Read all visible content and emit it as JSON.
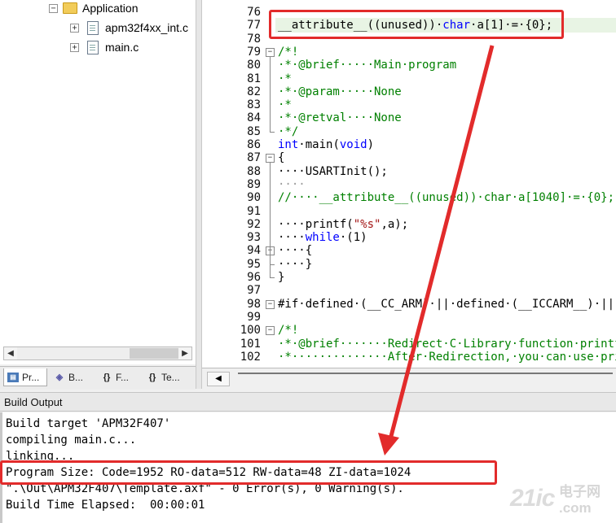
{
  "project_panel": {
    "tree": [
      {
        "label": "Application",
        "type": "folder",
        "expander": "−"
      },
      {
        "label": "apm32f4xx_int.c",
        "type": "file",
        "expander": "+"
      },
      {
        "label": "main.c",
        "type": "file",
        "expander": "+"
      }
    ],
    "tabs": [
      {
        "icon": "project-icon",
        "label": "Pr..."
      },
      {
        "icon": "books-icon",
        "label": "B..."
      },
      {
        "icon": "{}",
        "label": "F..."
      },
      {
        "icon": "{}",
        "label": "Te..."
      }
    ]
  },
  "editor": {
    "lines": [
      {
        "n": "76",
        "segments": []
      },
      {
        "n": "77",
        "segments": [
          {
            "t": "__attribute__((unused))·",
            "c": ""
          },
          {
            "t": "char",
            "c": "kw"
          },
          {
            "t": "·a[1]·=·{0};",
            "c": ""
          }
        ]
      },
      {
        "n": "78",
        "segments": []
      },
      {
        "n": "79",
        "segments": [
          {
            "t": "/*!",
            "c": "cmt"
          }
        ],
        "fold": "−"
      },
      {
        "n": "80",
        "segments": [
          {
            "t": "·*·@brief·····Main·program",
            "c": "cmt"
          }
        ]
      },
      {
        "n": "81",
        "segments": [
          {
            "t": "·*",
            "c": "cmt"
          }
        ]
      },
      {
        "n": "82",
        "segments": [
          {
            "t": "·*·@param·····None",
            "c": "cmt"
          }
        ]
      },
      {
        "n": "83",
        "segments": [
          {
            "t": "·*",
            "c": "cmt"
          }
        ]
      },
      {
        "n": "84",
        "segments": [
          {
            "t": "·*·@retval····None",
            "c": "cmt"
          }
        ]
      },
      {
        "n": "85",
        "segments": [
          {
            "t": "·*/",
            "c": "cmt"
          }
        ]
      },
      {
        "n": "86",
        "segments": [
          {
            "t": "int",
            "c": "kw"
          },
          {
            "t": "·main(",
            "c": ""
          },
          {
            "t": "void",
            "c": "kw"
          },
          {
            "t": ")",
            "c": ""
          }
        ]
      },
      {
        "n": "87",
        "segments": [
          {
            "t": "{",
            "c": ""
          }
        ],
        "fold": "−"
      },
      {
        "n": "88",
        "segments": [
          {
            "t": "····USARTInit();",
            "c": ""
          }
        ]
      },
      {
        "n": "89",
        "segments": [
          {
            "t": "····",
            "c": "dot"
          }
        ]
      },
      {
        "n": "90",
        "segments": [
          {
            "t": "//····__attribute__((unused))·char·a[1040]·=·{0};",
            "c": "cmt"
          }
        ]
      },
      {
        "n": "91",
        "segments": []
      },
      {
        "n": "92",
        "segments": [
          {
            "t": "····printf(",
            "c": ""
          },
          {
            "t": "\"%s\"",
            "c": "str"
          },
          {
            "t": ",a);",
            "c": ""
          }
        ]
      },
      {
        "n": "93",
        "segments": [
          {
            "t": "····",
            "c": ""
          },
          {
            "t": "while",
            "c": "kw"
          },
          {
            "t": "·(1)",
            "c": ""
          }
        ]
      },
      {
        "n": "94",
        "segments": [
          {
            "t": "····{",
            "c": ""
          }
        ],
        "fold": "−"
      },
      {
        "n": "95",
        "segments": [
          {
            "t": "····}",
            "c": ""
          }
        ]
      },
      {
        "n": "96",
        "segments": [
          {
            "t": "}",
            "c": ""
          }
        ]
      },
      {
        "n": "97",
        "segments": []
      },
      {
        "n": "98",
        "segments": [
          {
            "t": "#if·defined·(__CC_ARM)·||·defined·(__ICCARM__)·||·",
            "c": ""
          }
        ],
        "fold": "−"
      },
      {
        "n": "99",
        "segments": []
      },
      {
        "n": "100",
        "segments": [
          {
            "t": "/*!",
            "c": "cmt"
          }
        ],
        "fold": "−"
      },
      {
        "n": "101",
        "segments": [
          {
            "t": "·*·@brief·······Redirect·C·Library·function·printf·to",
            "c": "cmt"
          }
        ]
      },
      {
        "n": "102",
        "segments": [
          {
            "t": "·*··············After·Redirection,·you·can·use·printf",
            "c": "cmt"
          }
        ]
      }
    ]
  },
  "build_output": {
    "title": "Build Output",
    "lines": [
      "Build target 'APM32F407'",
      "compiling main.c...",
      "linking...",
      "Program Size: Code=1952 RO-data=512 RW-data=48 ZI-data=1024",
      "\".\\Out\\APM32F407\\Template.axf\" - 0 Error(s), 0 Warning(s).",
      "Build Time Elapsed:  00:00:01"
    ]
  },
  "watermark": {
    "text_big": "21ic",
    "text_cn": "电子网",
    "text_web": ".com"
  },
  "colors": {
    "annotation_red": "#e22b2b",
    "comment_green": "#008000",
    "keyword_blue": "#0000ff"
  }
}
